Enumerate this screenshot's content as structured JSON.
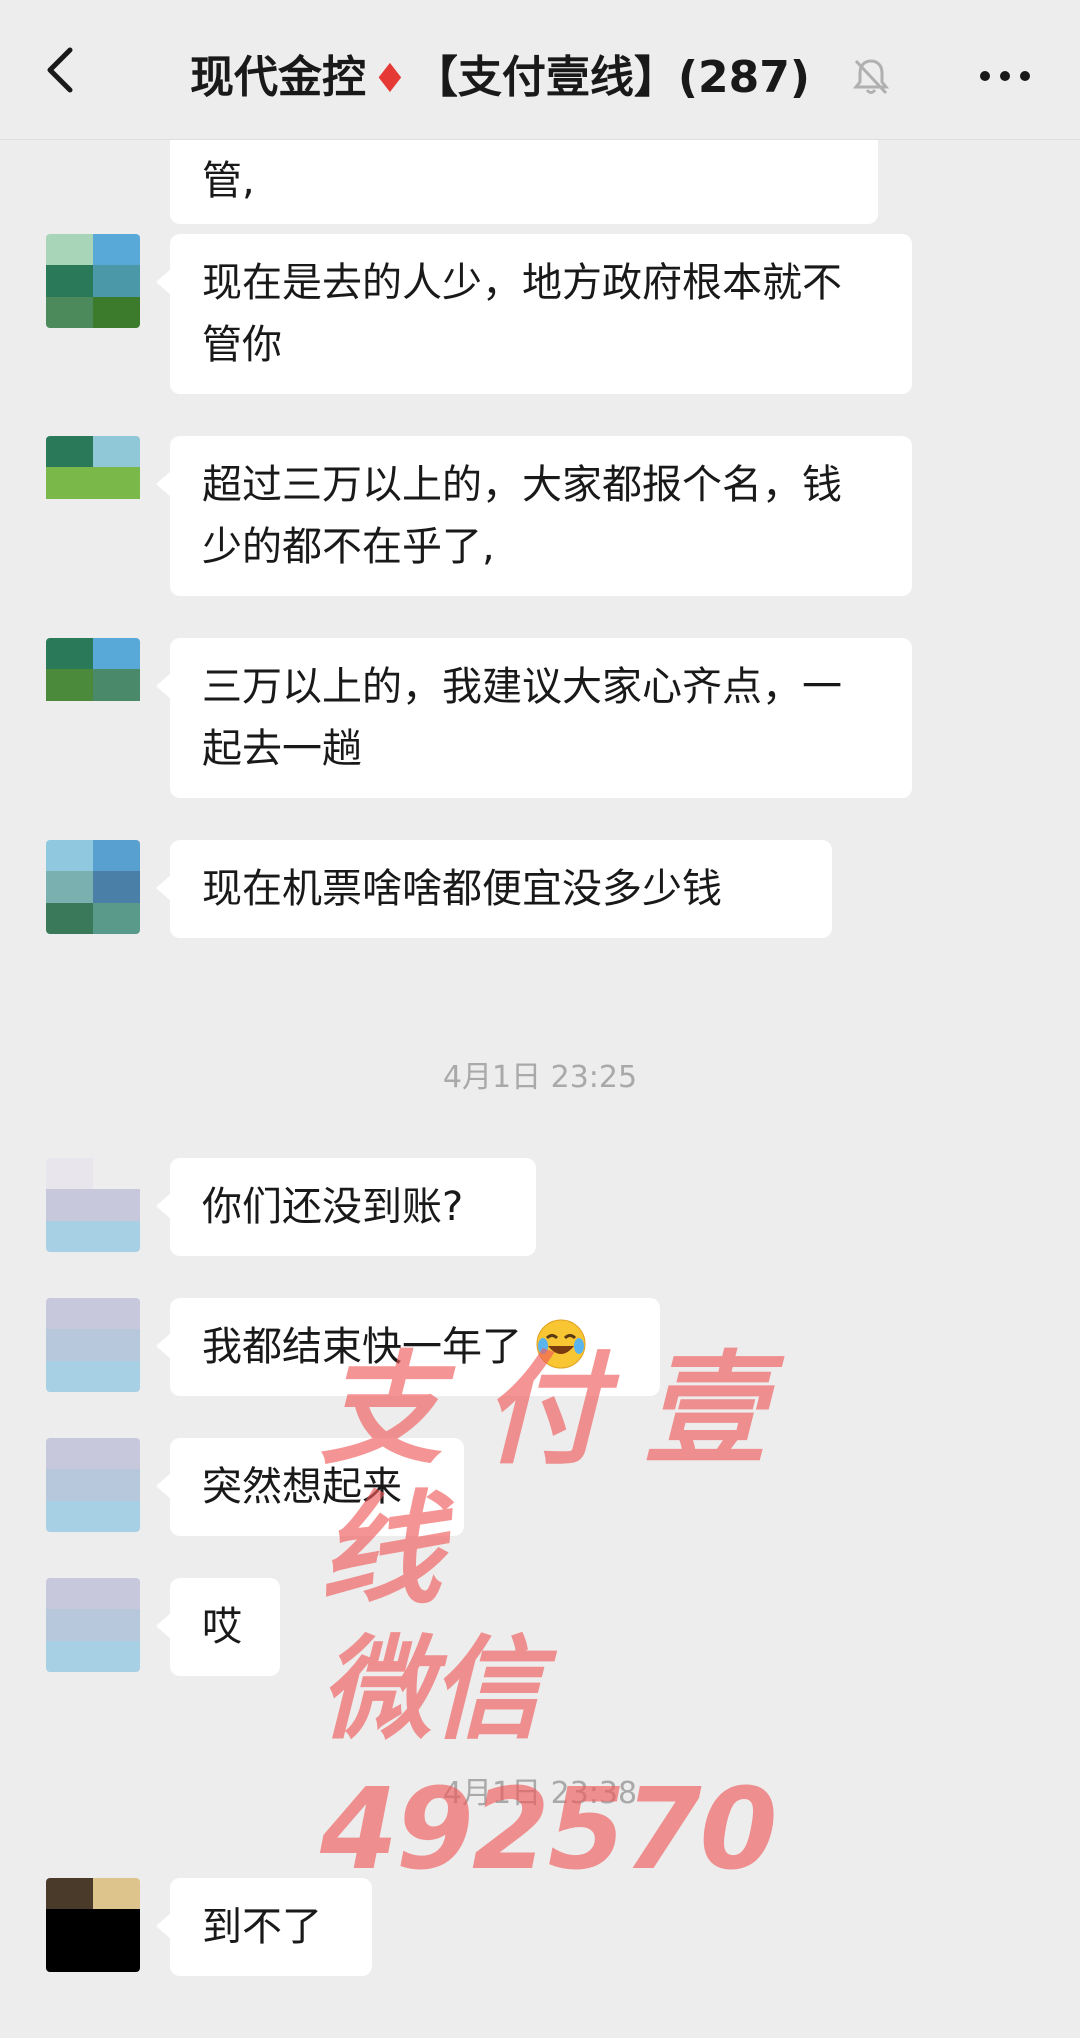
{
  "header": {
    "title_main": "现代金控",
    "title_diamond": "♦",
    "title_group": "【支付壹线】(287)"
  },
  "messages": [
    {
      "text": "管,"
    },
    {
      "text": "现在是去的人少，地方政府根本就不管你"
    },
    {
      "text": "超过三万以上的，大家都报个名，钱少的都不在乎了,"
    },
    {
      "text": "三万以上的，我建议大家心齐点，一起去一趟"
    },
    {
      "text": "现在机票啥啥都便宜没多少钱"
    },
    {
      "text": "你们还没到账?"
    },
    {
      "text": "我都结束快一年了"
    },
    {
      "text": "突然想起来"
    },
    {
      "text": "哎"
    },
    {
      "text": "到不了"
    }
  ],
  "timestamps": [
    "4月1日 23:25",
    "4月1日 23:38"
  ],
  "watermark": {
    "line1": "支付壹线",
    "line2": "微信492570"
  },
  "colors": {
    "background": "#ededed",
    "bubble": "#ffffff",
    "watermark": "#f05a5a",
    "timestamp": "#a9a9a9"
  },
  "icons": {
    "back": "chevron-left-icon",
    "mute": "bell-off-icon",
    "more": "ellipsis-icon",
    "emoji": "crying-laughing-emoji"
  }
}
